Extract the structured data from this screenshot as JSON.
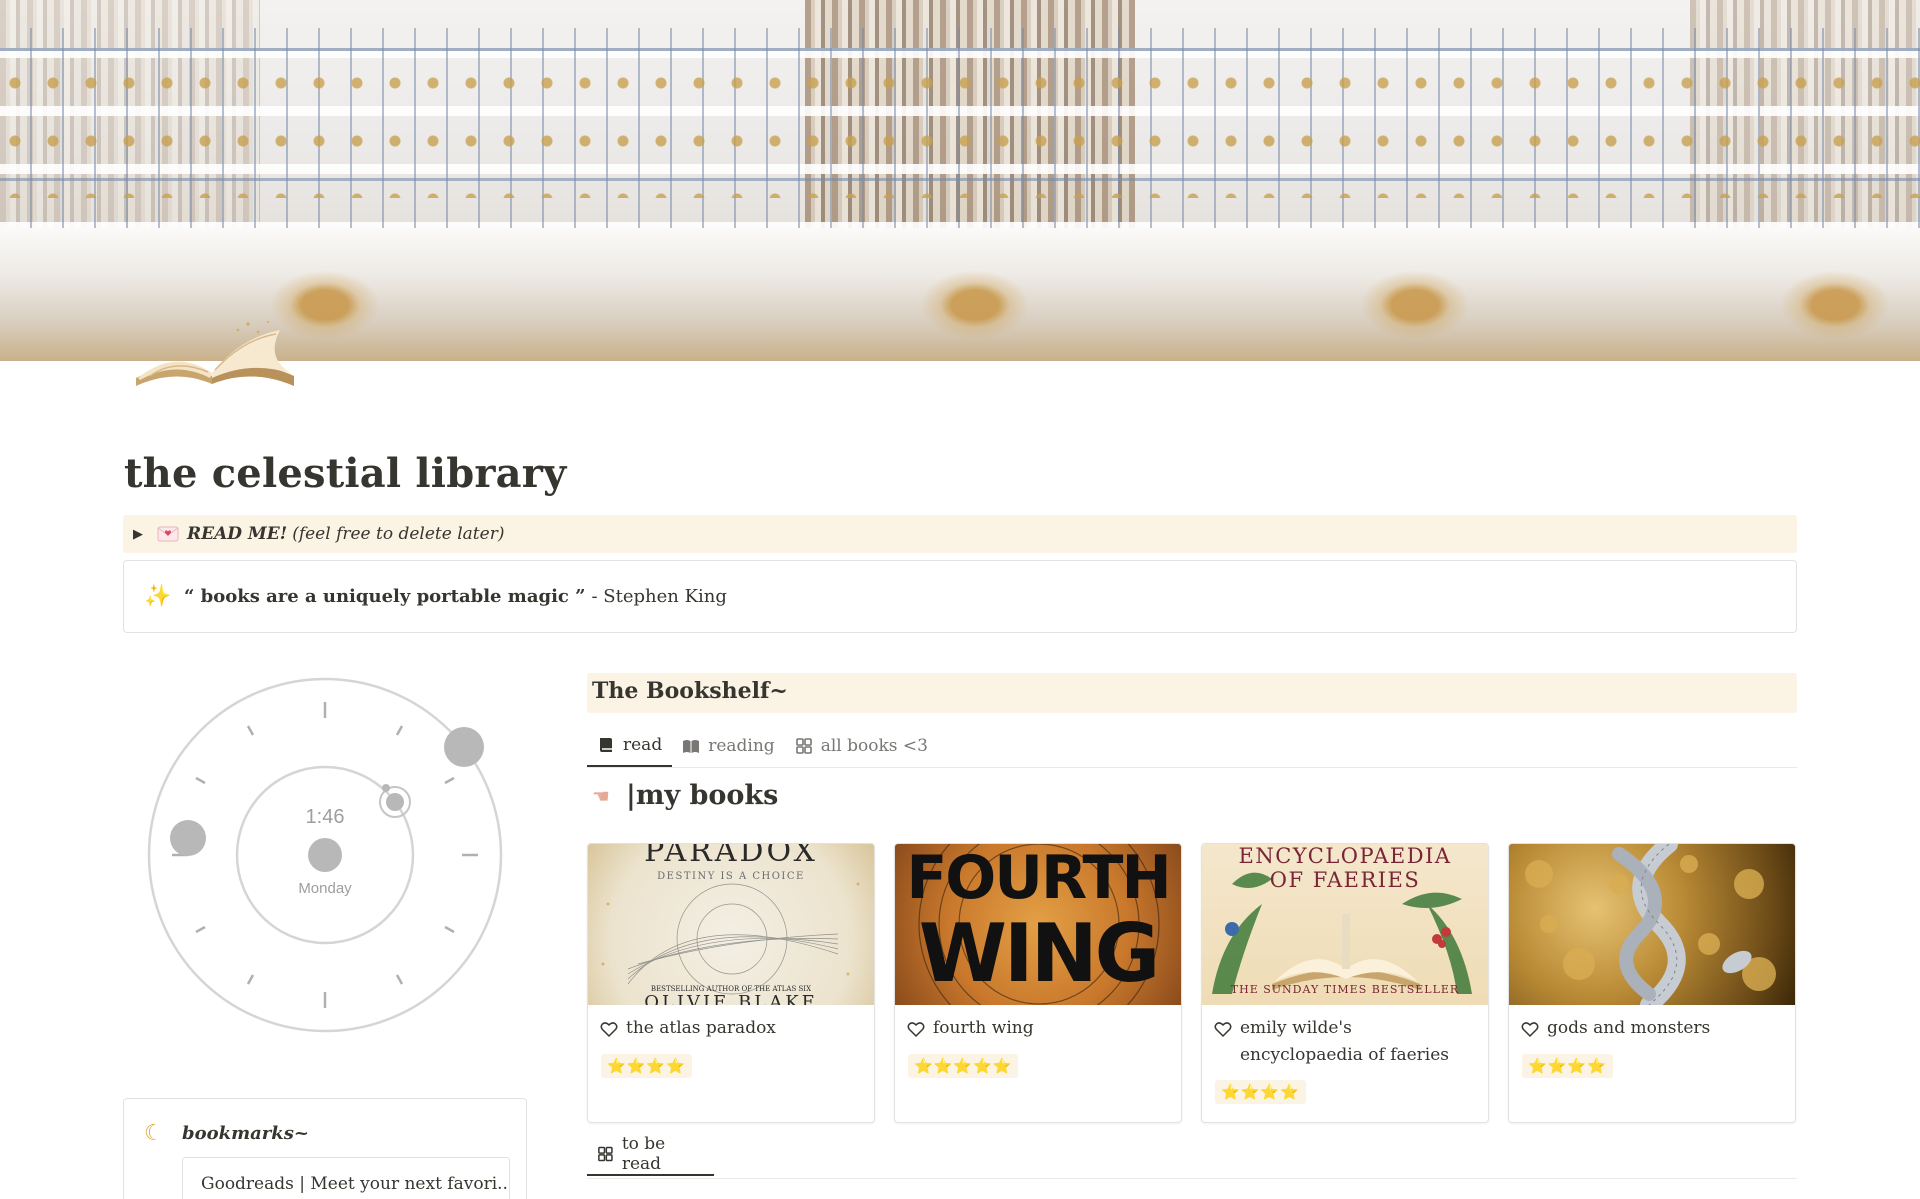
{
  "page": {
    "title": "the celestial library"
  },
  "readme_callout": {
    "bold": "READ ME!",
    "rest": "(feel free to delete later)"
  },
  "quote_callout": {
    "quote": "“ books are a uniquely portable magic ”",
    "author": "- Stephen King"
  },
  "clock": {
    "time": "1:46",
    "day": "Monday"
  },
  "bookmarks": {
    "title": "bookmarks~",
    "link": "Goodreads | Meet your next favori..."
  },
  "bookshelf": {
    "title": "The Bookshelf~",
    "tabs": [
      {
        "label": "read",
        "icon": "book-closed-icon",
        "active": true
      },
      {
        "label": "reading",
        "icon": "book-open-icon",
        "active": false
      },
      {
        "label": "all books <3",
        "icon": "gallery-grid-icon",
        "active": false
      }
    ],
    "section_title": "|my books",
    "books": [
      {
        "title": "the atlas paradox",
        "rating": "⭐⭐⭐⭐",
        "cover_text": [
          "PARADOX",
          "DESTINY IS A CHOICE",
          "BESTSELLING AUTHOR OF THE ATLAS SIX",
          "OLIVIE BLAKE"
        ]
      },
      {
        "title": "fourth wing",
        "rating": "⭐⭐⭐⭐⭐",
        "cover_text": [
          "FOURTH",
          "WING"
        ]
      },
      {
        "title": "emily wilde's encyclopaedia of faeries",
        "rating": "⭐⭐⭐⭐",
        "cover_text": [
          "ENCYCLOPAEDIA",
          "OF FAERIES",
          "THE SUNDAY TIMES BESTSELLER"
        ]
      },
      {
        "title": "gods and monsters",
        "rating": "⭐⭐⭐⭐",
        "cover_text": []
      }
    ],
    "bottom_tab": {
      "label": "to be read",
      "icon": "gallery-grid-icon"
    }
  },
  "colors": {
    "callout_bg": "#fbf3e4",
    "text": "#37352f",
    "muted": "#787774",
    "border": "#e3e2e0"
  }
}
